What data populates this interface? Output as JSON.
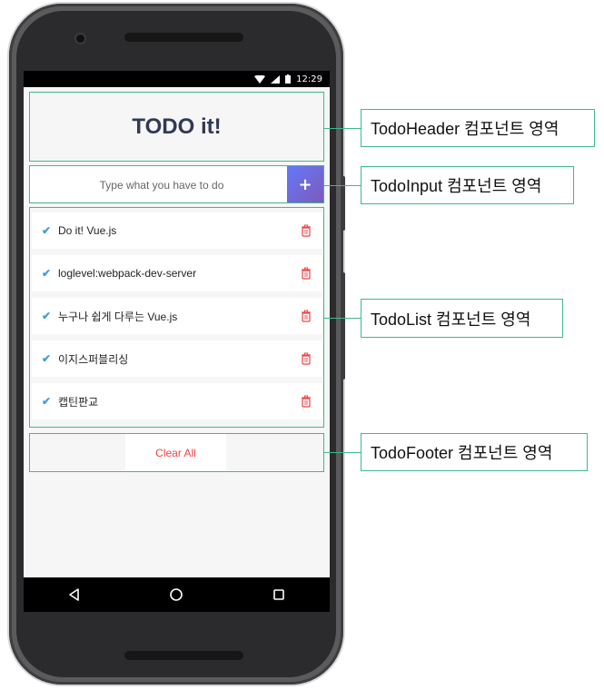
{
  "status_bar": {
    "time": "12:29"
  },
  "header": {
    "title": "TODO it!"
  },
  "input": {
    "placeholder": "Type what you have to do",
    "add_button": "+"
  },
  "todos": [
    {
      "text": "Do it! Vue.js",
      "completed": true
    },
    {
      "text": "loglevel:webpack-dev-server",
      "completed": true
    },
    {
      "text": "누구나 쉽게 다루는 Vue.js",
      "completed": true
    },
    {
      "text": "이지스퍼블리싱",
      "completed": true
    },
    {
      "text": "캡틴판교",
      "completed": true
    }
  ],
  "footer": {
    "clear_all": "Clear All"
  },
  "callouts": {
    "header": "TodoHeader 컴포넌트 영역",
    "input": "TodoInput 컴포넌트 영역",
    "list": "TodoList 컴포넌트 영역",
    "footer": "TodoFooter 컴포넌트 영역"
  },
  "colors": {
    "accent_border": "#3fb98b",
    "check": "#3da0dd",
    "delete": "#e44444",
    "add_button": "#6b6fd6"
  }
}
